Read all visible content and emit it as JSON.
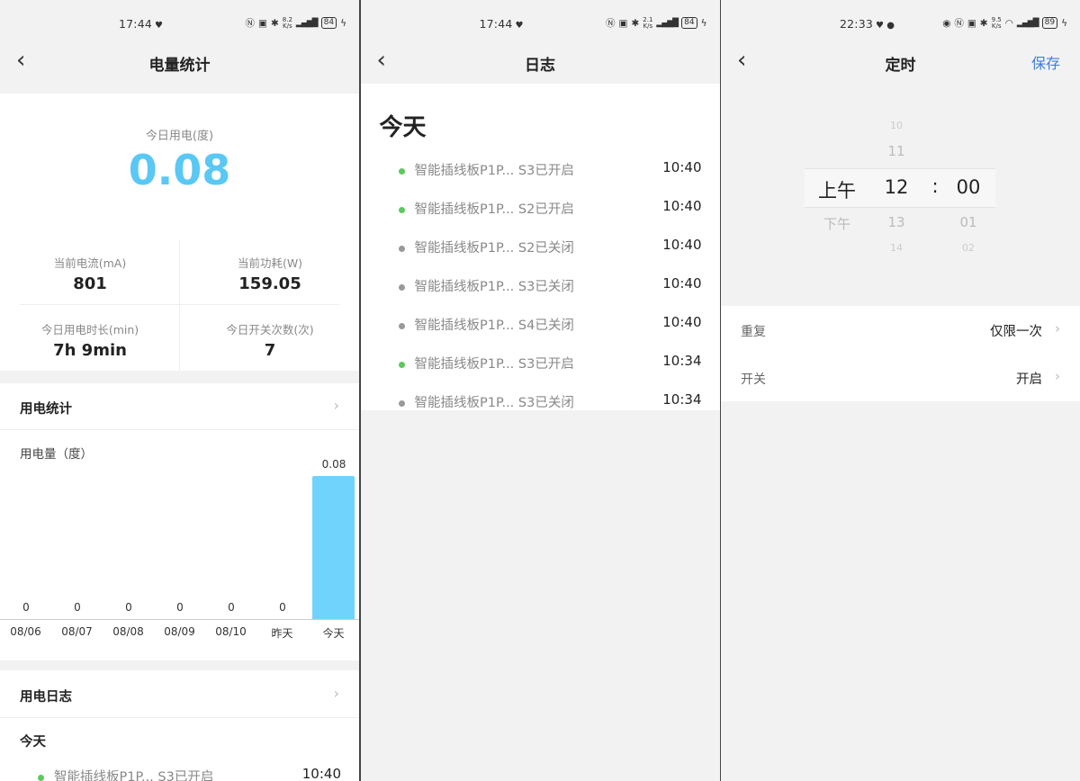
{
  "screens": [
    {
      "status": {
        "time": "17:44",
        "speed_top": "8.2",
        "speed_bottom": "K/s",
        "battery": "84"
      },
      "title": "电量统计",
      "today_label": "今日用电(度)",
      "today_value": "0.08",
      "metrics": [
        {
          "label": "当前电流(mA)",
          "value": "801"
        },
        {
          "label": "当前功耗(W)",
          "value": "159.05"
        },
        {
          "label": "今日用电时长(min)",
          "value": "7h 9min"
        },
        {
          "label": "今日开关次数(次)",
          "value": "7"
        }
      ],
      "stats_header": "用电统计",
      "log_header": "用电日志",
      "log_today": "今天",
      "log_first": {
        "text": "智能插线板P1P... S3已开启",
        "time": "10:40",
        "color": "#5cc95c"
      }
    },
    {
      "status": {
        "time": "17:44",
        "speed_top": "2.1",
        "speed_bottom": "K/s",
        "battery": "84"
      },
      "title": "日志",
      "today": "今天",
      "logs": [
        {
          "text": "智能插线板P1P... S3已开启",
          "time": "10:40",
          "color": "#5cc95c"
        },
        {
          "text": "智能插线板P1P... S2已开启",
          "time": "10:40",
          "color": "#5cc95c"
        },
        {
          "text": "智能插线板P1P... S2已关闭",
          "time": "10:40",
          "color": "#999999"
        },
        {
          "text": "智能插线板P1P... S3已关闭",
          "time": "10:40",
          "color": "#999999"
        },
        {
          "text": "智能插线板P1P... S4已关闭",
          "time": "10:40",
          "color": "#999999"
        },
        {
          "text": "智能插线板P1P... S3已开启",
          "time": "10:34",
          "color": "#5cc95c"
        },
        {
          "text": "智能插线板P1P... S3已关闭",
          "time": "10:34",
          "color": "#999999"
        }
      ]
    },
    {
      "status": {
        "time": "22:33",
        "speed_top": "9.5",
        "speed_bottom": "K/s",
        "battery": "89"
      },
      "title": "定时",
      "save": "保存",
      "picker": {
        "ampm": {
          "selected": "上午",
          "below": "下午"
        },
        "hour": {
          "above2": "10",
          "above1": "11",
          "selected": "12",
          "below1": "13",
          "below2": "14"
        },
        "separator": ":",
        "minute": {
          "selected": "00",
          "below1": "01",
          "below2": "02"
        }
      },
      "rows": [
        {
          "label": "重复",
          "value": "仅限一次"
        },
        {
          "label": "开关",
          "value": "开启"
        }
      ]
    }
  ],
  "chart_data": {
    "type": "bar",
    "title": "",
    "ylabel": "用电量（度）",
    "categories": [
      "08/06",
      "08/07",
      "08/08",
      "08/09",
      "08/10",
      "昨天",
      "今天"
    ],
    "values": [
      0,
      0,
      0,
      0,
      0,
      0,
      0.08
    ],
    "value_labels": [
      "0",
      "0",
      "0",
      "0",
      "0",
      "0",
      "0.08"
    ],
    "ylim": [
      0,
      0.08
    ],
    "bar_color": "#70d3fb"
  }
}
